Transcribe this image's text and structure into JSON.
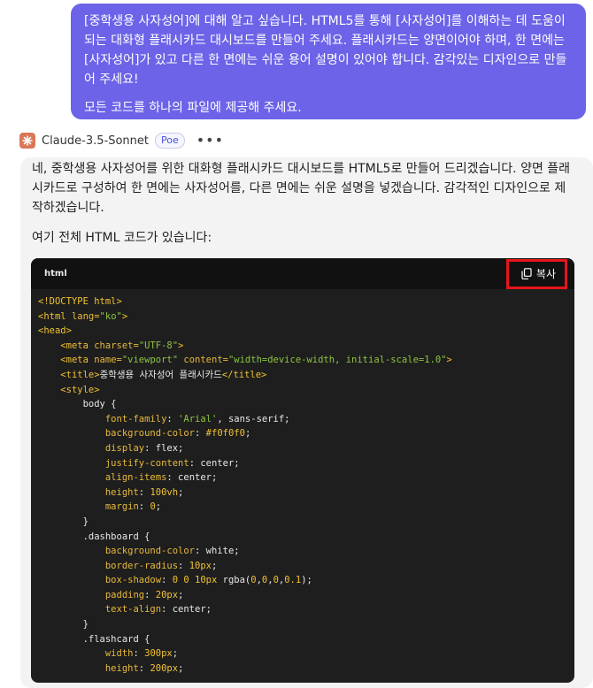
{
  "user_message": {
    "paragraph1": "[중학생용 사자성어]에 대해 알고 싶습니다. HTML5를 통해 [사자성어]를 이해하는 데 도움이 되는 대화형 플래시카드 대시보드를 만들어 주세요. 플래시카드는 양면이어야 하며, 한 면에는 [사자성어]가 있고 다른 한 면에는 쉬운 용어 설명이 있어야 합니다. 감각있는 디자인으로 만들어 주세요!",
    "paragraph2": "모든 코드를 하나의 파일에 제공해 주세요."
  },
  "bot": {
    "name": "Claude-3.5-Sonnet",
    "badge": "Poe",
    "more": "•••"
  },
  "bot_message": {
    "paragraph1": "네, 중학생용 사자성어를 위한 대화형 플래시카드 대시보드를 HTML5로 만들어 드리겠습니다. 양면 플래시카드로 구성하여 한 면에는 사자성어를, 다른 면에는 쉬운 설명을 넣겠습니다. 감각적인 디자인으로 제작하겠습니다.",
    "paragraph2": "여기 전체 HTML 코드가 있습니다:"
  },
  "code_block": {
    "language": "html",
    "copy_label": "복사",
    "lines": [
      [
        [
          "c-tag",
          "<!DOCTYPE html>"
        ]
      ],
      [
        [
          "c-tag",
          "<html "
        ],
        [
          "c-attr",
          "lang="
        ],
        [
          "c-str",
          "\"ko\""
        ],
        [
          "c-tag",
          ">"
        ]
      ],
      [
        [
          "c-tag",
          "<head>"
        ]
      ],
      [
        [
          "c-text",
          "    "
        ],
        [
          "c-tag",
          "<meta "
        ],
        [
          "c-attr",
          "charset="
        ],
        [
          "c-str",
          "\"UTF-8\""
        ],
        [
          "c-tag",
          ">"
        ]
      ],
      [
        [
          "c-text",
          "    "
        ],
        [
          "c-tag",
          "<meta "
        ],
        [
          "c-attr",
          "name="
        ],
        [
          "c-str",
          "\"viewport\" "
        ],
        [
          "c-attr",
          "content="
        ],
        [
          "c-str",
          "\"width=device-width, initial-scale=1.0\""
        ],
        [
          "c-tag",
          ">"
        ]
      ],
      [
        [
          "c-text",
          "    "
        ],
        [
          "c-tag",
          "<title>"
        ],
        [
          "c-text",
          "중학생용 사자성어 플래시카드"
        ],
        [
          "c-tag",
          "</title>"
        ]
      ],
      [
        [
          "c-text",
          "    "
        ],
        [
          "c-tag",
          "<style>"
        ]
      ],
      [
        [
          "c-sel",
          "        body {"
        ]
      ],
      [
        [
          "c-text",
          "            "
        ],
        [
          "c-prop",
          "font-family"
        ],
        [
          "c-val",
          ": "
        ],
        [
          "c-str",
          "'Arial'"
        ],
        [
          "c-val",
          ", sans-serif;"
        ]
      ],
      [
        [
          "c-text",
          "            "
        ],
        [
          "c-prop",
          "background-color"
        ],
        [
          "c-val",
          ": "
        ],
        [
          "c-num",
          "#f0f0f0"
        ],
        [
          "c-val",
          ";"
        ]
      ],
      [
        [
          "c-text",
          "            "
        ],
        [
          "c-prop",
          "display"
        ],
        [
          "c-val",
          ": flex;"
        ]
      ],
      [
        [
          "c-text",
          "            "
        ],
        [
          "c-prop",
          "justify-content"
        ],
        [
          "c-val",
          ": center;"
        ]
      ],
      [
        [
          "c-text",
          "            "
        ],
        [
          "c-prop",
          "align-items"
        ],
        [
          "c-val",
          ": center;"
        ]
      ],
      [
        [
          "c-text",
          "            "
        ],
        [
          "c-prop",
          "height"
        ],
        [
          "c-val",
          ": "
        ],
        [
          "c-num",
          "100vh"
        ],
        [
          "c-val",
          ";"
        ]
      ],
      [
        [
          "c-text",
          "            "
        ],
        [
          "c-prop",
          "margin"
        ],
        [
          "c-val",
          ": "
        ],
        [
          "c-num",
          "0"
        ],
        [
          "c-val",
          ";"
        ]
      ],
      [
        [
          "c-sel",
          "        }"
        ]
      ],
      [
        [
          "c-sel",
          "        .dashboard {"
        ]
      ],
      [
        [
          "c-text",
          "            "
        ],
        [
          "c-prop",
          "background-color"
        ],
        [
          "c-val",
          ": white;"
        ]
      ],
      [
        [
          "c-text",
          "            "
        ],
        [
          "c-prop",
          "border-radius"
        ],
        [
          "c-val",
          ": "
        ],
        [
          "c-num",
          "10px"
        ],
        [
          "c-val",
          ";"
        ]
      ],
      [
        [
          "c-text",
          "            "
        ],
        [
          "c-prop",
          "box-shadow"
        ],
        [
          "c-val",
          ": "
        ],
        [
          "c-num",
          "0 0 10px"
        ],
        [
          "c-val",
          " rgba("
        ],
        [
          "c-num",
          "0"
        ],
        [
          "c-val",
          ","
        ],
        [
          "c-num",
          "0"
        ],
        [
          "c-val",
          ","
        ],
        [
          "c-num",
          "0"
        ],
        [
          "c-val",
          ","
        ],
        [
          "c-num",
          "0.1"
        ],
        [
          "c-val",
          ");"
        ]
      ],
      [
        [
          "c-text",
          "            "
        ],
        [
          "c-prop",
          "padding"
        ],
        [
          "c-val",
          ": "
        ],
        [
          "c-num",
          "20px"
        ],
        [
          "c-val",
          ";"
        ]
      ],
      [
        [
          "c-text",
          "            "
        ],
        [
          "c-prop",
          "text-align"
        ],
        [
          "c-val",
          ": center;"
        ]
      ],
      [
        [
          "c-sel",
          "        }"
        ]
      ],
      [
        [
          "c-sel",
          "        .flashcard {"
        ]
      ],
      [
        [
          "c-text",
          "            "
        ],
        [
          "c-prop",
          "width"
        ],
        [
          "c-val",
          ": "
        ],
        [
          "c-num",
          "300px"
        ],
        [
          "c-val",
          ";"
        ]
      ],
      [
        [
          "c-text",
          "            "
        ],
        [
          "c-prop",
          "height"
        ],
        [
          "c-val",
          ": "
        ],
        [
          "c-num",
          "200px"
        ],
        [
          "c-val",
          ";"
        ]
      ]
    ]
  },
  "colors": {
    "user_bubble": "#6c63e8",
    "code_bg": "#1e1e1e",
    "copy_highlight": "#e8141c"
  }
}
